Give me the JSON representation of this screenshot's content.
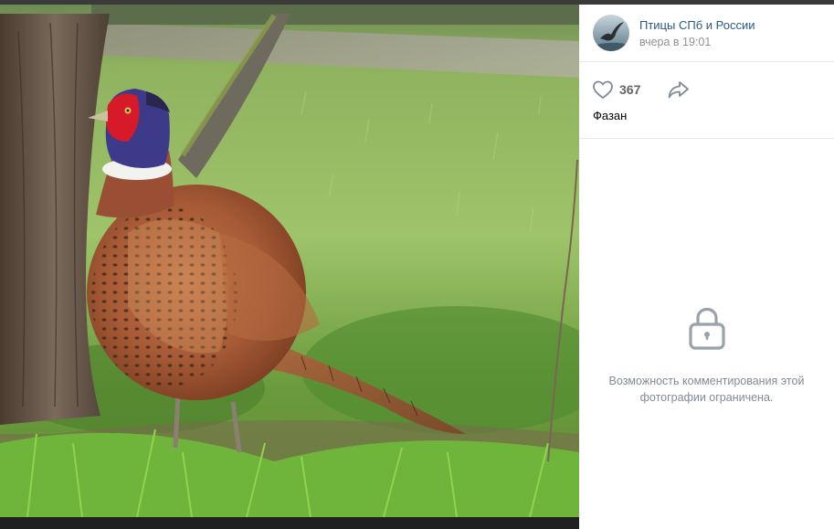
{
  "author": {
    "name": "Птицы СПб и России",
    "time": "вчера в 19:01"
  },
  "actions": {
    "like_count": "367"
  },
  "caption": "Фазан",
  "comments_notice": {
    "line1": "Возможность комментирования этой",
    "line2": "фотографии ограничена."
  },
  "icons": {
    "like": "heart-icon",
    "share": "share-arrow-icon",
    "lock": "lock-icon"
  },
  "colors": {
    "link": "#2a5885",
    "muted": "#939393",
    "icon": "#818c99"
  }
}
